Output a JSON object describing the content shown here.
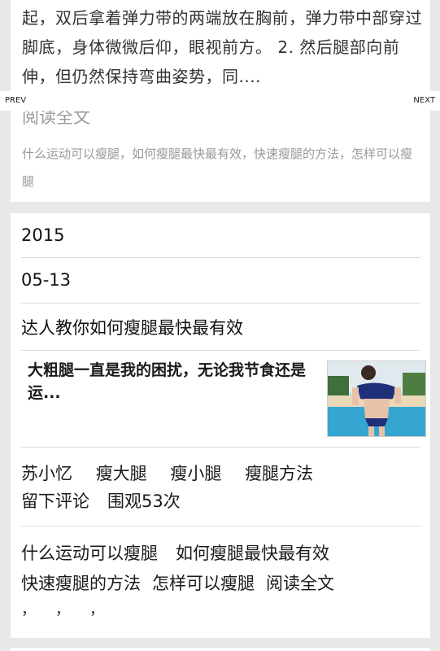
{
  "prev_article": {
    "excerpt": "起，双后拿着弹力带的两端放在胸前，弹力带中部穿过脚底，身体微微后仰，眼视前方。 2. 然后腿部向前伸，但仍然保持弯曲姿势，同....",
    "read_more": "阅读全文",
    "tags": [
      "什么运动可以瘦腿",
      "，如何瘦腿最快最有效",
      "，快速瘦腿的方法",
      "，怎样可以瘦腿"
    ]
  },
  "pager": {
    "prev_label": "PREV",
    "next_label": "NEXT"
  },
  "article": {
    "year": "2015",
    "date": "05-13",
    "title": "达人教你如何瘦腿最快最有效",
    "feature_text": "大粗腿一直是我的困扰，无论我节食还是运...",
    "thumbnail_icon": "swimsuit-photo",
    "author": "苏小忆",
    "categories": [
      "瘦大腿",
      "瘦小腿",
      "瘦腿方法"
    ],
    "comment_label": "留下评论",
    "views_label": "围观53次",
    "tags": [
      "什么运动可以瘦腿",
      "如何瘦腿最快最有效",
      "快速瘦腿的方法",
      "怎样可以瘦腿"
    ],
    "read_more": "阅读全文",
    "separators": [
      "，",
      "，",
      "，"
    ]
  },
  "colors": {
    "background": "#e8e8e8",
    "card": "#ffffff",
    "muted_text": "#9a9a9a",
    "main_text": "#111111",
    "divider": "#dcdcdc"
  }
}
